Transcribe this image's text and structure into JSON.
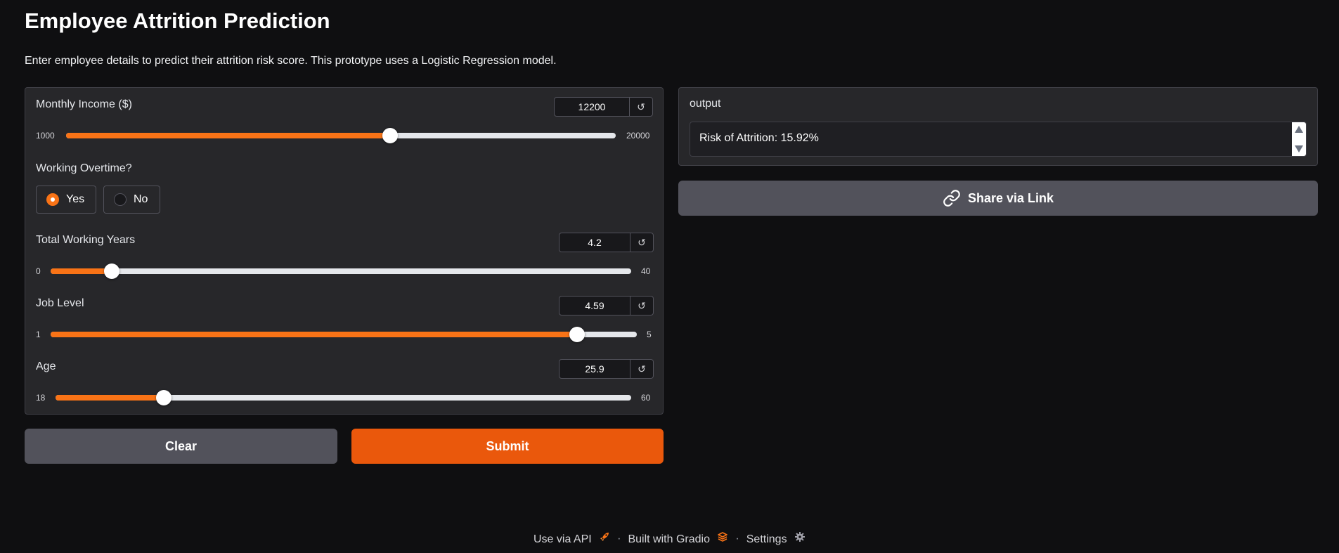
{
  "header": {
    "title": "Employee Attrition Prediction",
    "description": "Enter employee details to predict their attrition risk score. This prototype uses a Logistic Regression model."
  },
  "inputs": {
    "monthly_income": {
      "label": "Monthly Income ($)",
      "value": "12200",
      "min": "1000",
      "max": "20000",
      "fraction": 0.589
    },
    "overtime": {
      "label": "Working Overtime?",
      "options": [
        "Yes",
        "No"
      ],
      "selected": "Yes"
    },
    "total_working_years": {
      "label": "Total Working Years",
      "value": "4.2",
      "min": "0",
      "max": "40",
      "fraction": 0.105
    },
    "job_level": {
      "label": "Job Level",
      "value": "4.59",
      "min": "1",
      "max": "5",
      "fraction": 0.8975
    },
    "age": {
      "label": "Age",
      "value": "25.9",
      "min": "18",
      "max": "60",
      "fraction": 0.188
    }
  },
  "actions": {
    "clear_label": "Clear",
    "submit_label": "Submit",
    "reset_glyph": "↺"
  },
  "output": {
    "label": "output",
    "text": "Risk of Attrition: 15.92%"
  },
  "share": {
    "label": "Share via Link",
    "icon": "link-icon"
  },
  "footer": {
    "api_label": "Use via API",
    "built_label": "Built with Gradio",
    "settings_label": "Settings",
    "separator": "·"
  },
  "colors": {
    "accent": "#f97316",
    "submit": "#ea580c",
    "clear": "#52525b",
    "panel": "#27272a",
    "background": "#0f0f11"
  }
}
